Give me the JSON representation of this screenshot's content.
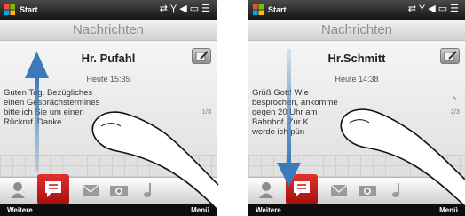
{
  "statusbar": {
    "start_label": "Start"
  },
  "app": {
    "title": "Nachrichten"
  },
  "softkeys": {
    "left": "Weitere",
    "right": "Menü"
  },
  "screens": [
    {
      "sender": "Hr. Pufahl",
      "timestamp": "Heute 15:35",
      "body_lines": [
        "Guten Tag. Bezügliches",
        "einen Gesprächstermines",
        "bitte ich Sie um einen",
        "Rückruf. Danke"
      ],
      "page_counter": "1/3",
      "gesture": "swipe-up"
    },
    {
      "sender": "Hr.Schmitt",
      "timestamp": "Heute 14:38",
      "body_lines": [
        "Grüß Gott! Wie",
        "besprochen, ankomme",
        "gegen 20 Uhr am",
        "Bahnhof. Zur K",
        "werde ich pün"
      ],
      "page_counter": "2/3",
      "gesture": "swipe-down"
    }
  ],
  "colors": {
    "accent": "#d61f1c",
    "arrow": "#3b79b8",
    "statusbar": "#1a1a1a",
    "title": "#8e8e8e"
  },
  "icons": [
    "windows-flag-icon",
    "sync-icon",
    "signal-icon",
    "volume-icon",
    "battery-icon",
    "menu-icon",
    "compose-icon",
    "contacts-icon",
    "messages-icon",
    "email-icon",
    "photos-icon",
    "music-icon"
  ]
}
